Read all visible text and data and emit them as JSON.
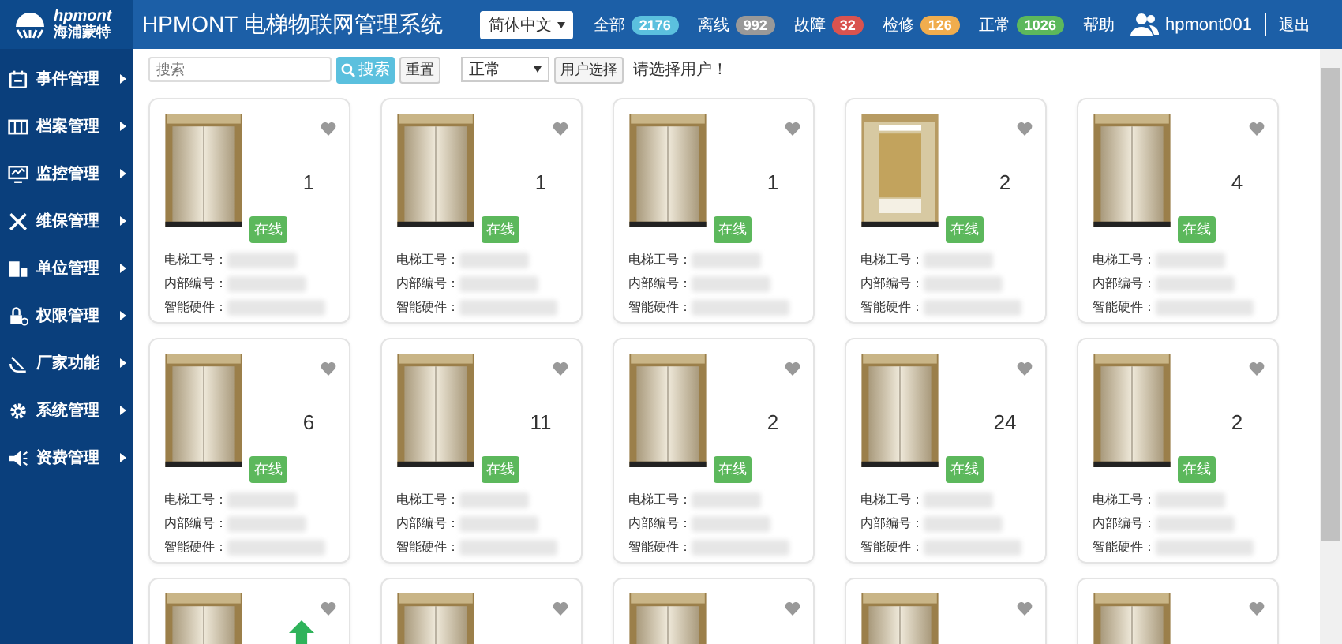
{
  "logo": {
    "brand": "hpmont",
    "name": "海浦蒙特"
  },
  "header": {
    "title": "HPMONT 电梯物联网管理系统",
    "language": "简体中文",
    "help": "帮助",
    "user": "hpmont001",
    "logout": "退出",
    "counters": [
      {
        "label": "全部",
        "count": "2176",
        "color": "#5bc0de"
      },
      {
        "label": "离线",
        "count": "992",
        "color": "#999999"
      },
      {
        "label": "故障",
        "count": "32",
        "color": "#d9534f"
      },
      {
        "label": "检修",
        "count": "126",
        "color": "#f0ad4e"
      },
      {
        "label": "正常",
        "count": "1026",
        "color": "#5cb85c"
      }
    ]
  },
  "sidebar": {
    "items": [
      {
        "label": "事件管理"
      },
      {
        "label": "档案管理"
      },
      {
        "label": "监控管理"
      },
      {
        "label": "维保管理"
      },
      {
        "label": "单位管理"
      },
      {
        "label": "权限管理"
      },
      {
        "label": "厂家功能"
      },
      {
        "label": "系统管理"
      },
      {
        "label": "资费管理"
      }
    ]
  },
  "toolbar": {
    "search": {
      "placeholder": "搜索"
    },
    "search_button": "搜索",
    "reset_button": "重置",
    "status_filter": "正常",
    "user_select_button": "用户选择",
    "hint": "请选择用户！"
  },
  "cards": [
    {
      "kind": "doors",
      "number": "1",
      "status": "在线",
      "fields": [
        "电梯工号：",
        "内部编号：",
        "智能硬件："
      ],
      "arrow_up": false
    },
    {
      "kind": "doors",
      "number": "1",
      "status": "在线",
      "fields": [
        "电梯工号：",
        "内部编号：",
        "智能硬件："
      ],
      "arrow_up": false
    },
    {
      "kind": "doors",
      "number": "1",
      "status": "在线",
      "fields": [
        "电梯工号：",
        "内部编号：",
        "智能硬件："
      ],
      "arrow_up": false
    },
    {
      "kind": "cabin",
      "number": "2",
      "status": "在线",
      "fields": [
        "电梯工号：",
        "内部编号：",
        "智能硬件："
      ],
      "arrow_up": false
    },
    {
      "kind": "doors",
      "number": "4",
      "status": "在线",
      "fields": [
        "电梯工号：",
        "内部编号：",
        "智能硬件："
      ],
      "arrow_up": false
    },
    {
      "kind": "doors",
      "number": "6",
      "status": "在线",
      "fields": [
        "电梯工号：",
        "内部编号：",
        "智能硬件："
      ],
      "arrow_up": false
    },
    {
      "kind": "doors",
      "number": "11",
      "status": "在线",
      "fields": [
        "电梯工号：",
        "内部编号：",
        "智能硬件："
      ],
      "arrow_up": false
    },
    {
      "kind": "doors",
      "number": "2",
      "status": "在线",
      "fields": [
        "电梯工号：",
        "内部编号：",
        "智能硬件："
      ],
      "arrow_up": false
    },
    {
      "kind": "doors",
      "number": "24",
      "status": "在线",
      "fields": [
        "电梯工号：",
        "内部编号：",
        "智能硬件："
      ],
      "arrow_up": false
    },
    {
      "kind": "doors",
      "number": "2",
      "status": "在线",
      "fields": [
        "电梯工号：",
        "内部编号：",
        "智能硬件："
      ],
      "arrow_up": false
    },
    {
      "kind": "doors",
      "arrow_up": true
    },
    {
      "kind": "doors",
      "arrow_up": false
    },
    {
      "kind": "doors",
      "arrow_up": false
    },
    {
      "kind": "doors",
      "arrow_up": false
    },
    {
      "kind": "doors",
      "arrow_up": false
    }
  ]
}
